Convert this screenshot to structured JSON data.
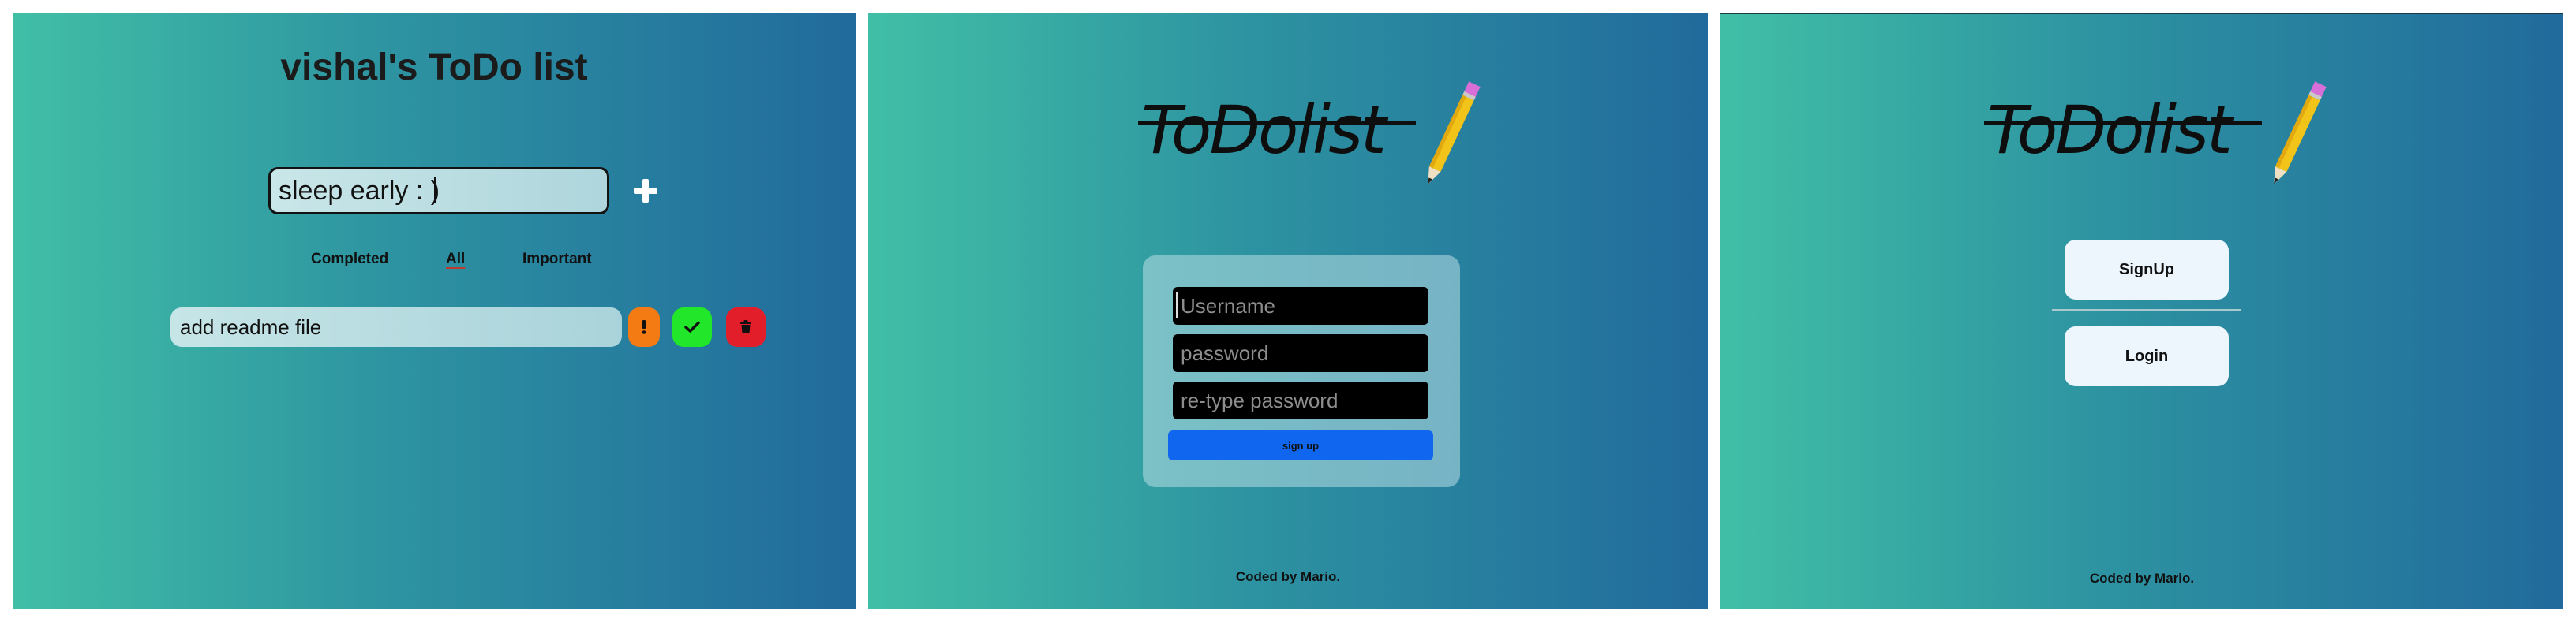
{
  "panel_todo": {
    "title": "vishal's ToDo list",
    "input_value": "sleep early : )",
    "add_button_icon": "plus-icon",
    "filters": [
      {
        "label": "Completed",
        "active": false
      },
      {
        "label": "All",
        "active": true
      },
      {
        "label": "Important",
        "active": false
      }
    ],
    "tasks": [
      {
        "text": "add readme file",
        "actions": [
          "exclamation-icon",
          "check-icon",
          "trash-icon"
        ]
      }
    ],
    "colors": {
      "important": "#f47b14",
      "complete": "#22e629",
      "delete": "#e21e2b"
    }
  },
  "panel_signup": {
    "logo_text": "ToDolist",
    "username_placeholder": "Username",
    "password_placeholder": "password",
    "retype_placeholder": "re-type password",
    "submit_label": "sign up",
    "footer": "Coded by Mario.",
    "accent": "#1166f0"
  },
  "panel_menu": {
    "logo_text": "ToDolist",
    "signup_label": "SignUp",
    "login_label": "Login",
    "footer": "Coded by Mario."
  },
  "gradient": {
    "start": "#41bfa6",
    "end": "#216a9c"
  }
}
